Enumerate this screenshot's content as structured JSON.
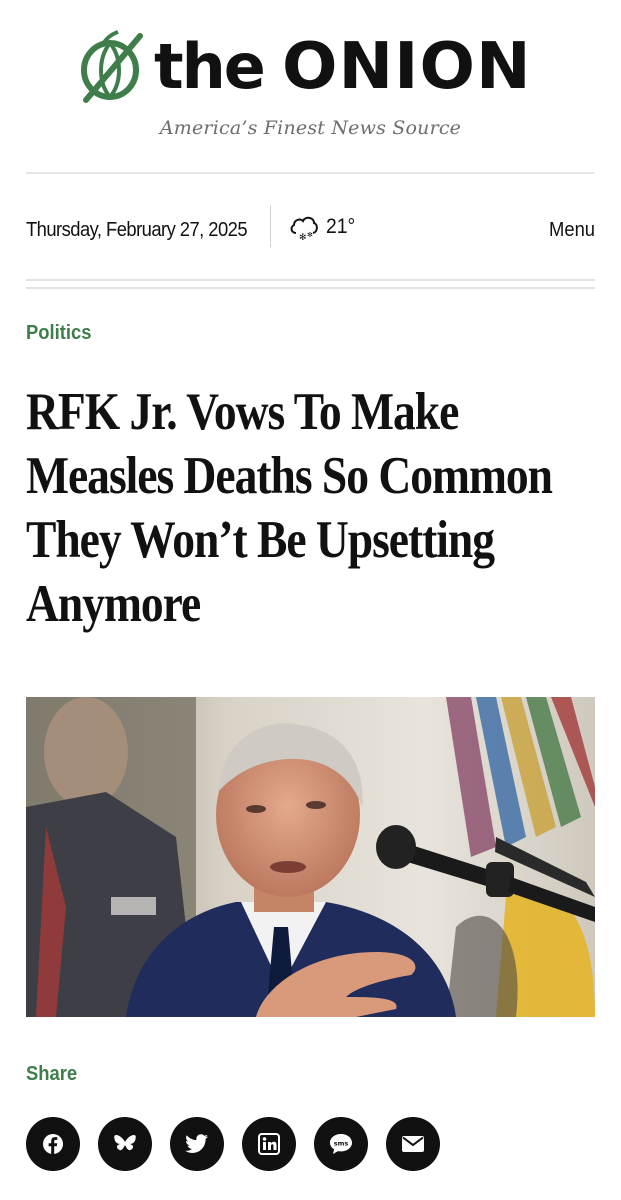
{
  "masthead": {
    "logo_word_the": "the",
    "logo_word_onion": "ONION",
    "tagline": "America’s Finest News Source"
  },
  "infobar": {
    "date": "Thursday, February 27, 2025",
    "temperature": "21°",
    "weather_icon": "snow-cloud-icon",
    "menu_label": "Menu"
  },
  "article": {
    "section": "Politics",
    "headline": "RFK Jr. Vows To Make Measles Deaths So Common They Won’t Be Upsetting Anymore"
  },
  "share": {
    "label": "Share",
    "buttons": [
      {
        "icon": "facebook-icon"
      },
      {
        "icon": "bluesky-icon"
      },
      {
        "icon": "twitter-icon"
      },
      {
        "icon": "linkedin-icon"
      },
      {
        "icon": "sms-icon",
        "text": "sms"
      },
      {
        "icon": "email-icon"
      }
    ]
  },
  "colors": {
    "brand_green": "#3f7d4a",
    "text": "#111111",
    "tagline_gray": "#6d6d6d",
    "rule": "#e3e3e3"
  }
}
